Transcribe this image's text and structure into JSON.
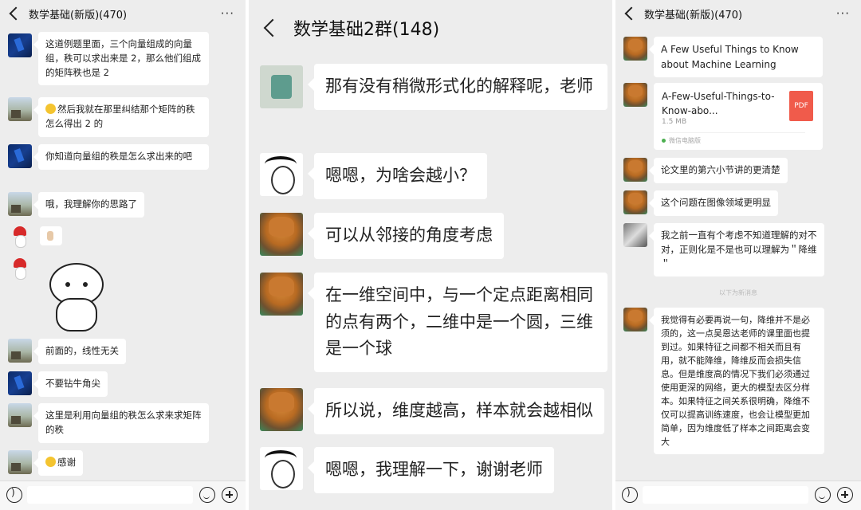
{
  "left_panel": {
    "title": "数学基础(新版)(470)",
    "more_icon": "···",
    "messages": [
      {
        "avatar": "blue",
        "text": "这道例题里面，三个向量组成的向量组，秩可以求出来是 2，那么他们组成的矩阵秩也是 2"
      },
      {
        "avatar": "land",
        "text": "然后我就在那里纠结那个矩阵的秩怎么得出 2 的",
        "emoji": "sweat-smile"
      },
      {
        "avatar": "blue",
        "text": "你知道向量组的秩是怎么求出来的吧"
      },
      {
        "avatar": "land",
        "text": "哦，我理解你的思路了"
      },
      {
        "avatar": "santa",
        "type": "thumbs-up-sticker"
      },
      {
        "avatar": "santa",
        "type": "bear-sticker"
      },
      {
        "avatar": "land",
        "text": "前面的，线性无关"
      },
      {
        "avatar": "blue",
        "text": "不要钻牛角尖"
      },
      {
        "avatar": "land",
        "text": "这里是利用向量组的秩怎么求来求矩阵的秩"
      },
      {
        "avatar": "land",
        "text": "感谢",
        "emoji": "sweat-smile"
      }
    ]
  },
  "middle_panel": {
    "title": "数学基础2群(148)",
    "messages": [
      {
        "avatar": "robot",
        "text": "那有没有稍微形式化的解释呢，老师"
      },
      {
        "avatar": "face",
        "text": "嗯嗯，为啥会越小？"
      },
      {
        "avatar": "cat",
        "text": "可以从邻接的角度考虑"
      },
      {
        "avatar": "cat",
        "text": "在一维空间中，与一个定点距离相同的点有两个，二维中是一个圆，三维是一个球"
      },
      {
        "avatar": "cat",
        "text": "所以说，维度越高，样本就会越相似"
      },
      {
        "avatar": "face",
        "text": "嗯嗯，我理解一下，谢谢老师"
      }
    ]
  },
  "right_panel": {
    "title": "数学基础(新版)(470)",
    "more_icon": "···",
    "messages": [
      {
        "avatar": "cat",
        "text": "A Few Useful Things to Know about Machine Learning"
      },
      {
        "avatar": "cat",
        "type": "file",
        "file_name": "A-Few-Useful-Things-to-Know-abo...",
        "file_size": "1.5 MB",
        "file_icon": "PDF",
        "footer": "微信电脑版"
      },
      {
        "avatar": "cat",
        "text": "论文里的第六小节讲的更清楚"
      },
      {
        "avatar": "cat",
        "text": "这个问题在图像领域更明显"
      },
      {
        "avatar": "small",
        "text": "我之前一直有个考虑不知道理解的对不对，正则化是不是也可以理解为＂降维＂"
      },
      {
        "type": "notice",
        "text": "以下为新消息"
      },
      {
        "avatar": "cat",
        "text": "我觉得有必要再说一句，降维并不是必须的，这一点吴恩达老师的课里面也提到过。如果特征之间都不相关而且有用，就不能降维，降维反而会损失信息。但是维度高的情况下我们必须通过使用更深的网络，更大的模型去区分样本。如果特征之间关系很明确，降维不仅可以提高训练速度，也会让模型更加简单，因为维度低了样本之间距离会变大"
      }
    ]
  },
  "input_bar": {
    "voice_icon": "voice-icon",
    "emoji_icon": "smile-icon",
    "more_icon": "plus-icon"
  }
}
